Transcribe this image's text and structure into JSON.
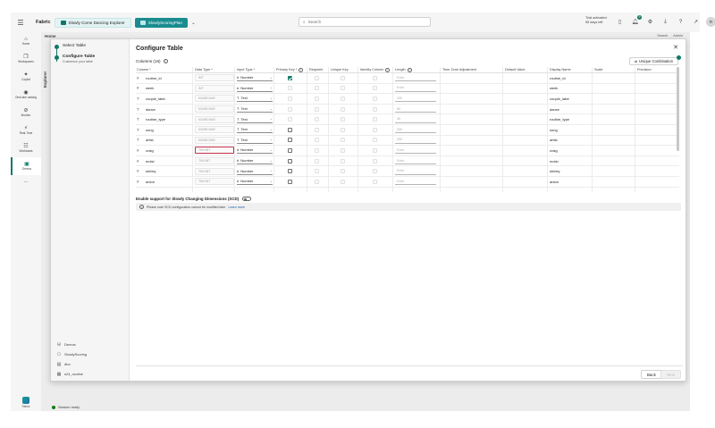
{
  "topbar": {
    "app_name": "Fabric",
    "tabs": [
      {
        "label": "Slowly Come Dancing Explorer",
        "active": false
      },
      {
        "label": "SlowlyScoringPlan",
        "active": true
      }
    ],
    "add_tab": "+",
    "search_placeholder": "Search",
    "trial_line1": "Trial activated:",
    "trial_line2": "55 days left",
    "notification_count": "9",
    "avatar_initials": "R"
  },
  "rail": {
    "items": [
      {
        "label": "Home",
        "icon": "home-icon"
      },
      {
        "label": "Workspaces",
        "icon": "workspaces-icon"
      },
      {
        "label": "Copilot",
        "icon": "copilot-icon"
      },
      {
        "label": "OneLake catalog",
        "icon": "onelake-icon"
      },
      {
        "label": "Monitor",
        "icon": "monitor-icon"
      },
      {
        "label": "Real-Time",
        "icon": "realtime-icon"
      },
      {
        "label": "Workloads",
        "icon": "workloads-icon"
      },
      {
        "label": "Demos",
        "icon": "demos-icon"
      }
    ],
    "more": "...",
    "bottom_label": "Fabric"
  },
  "background": {
    "home_tab": "Home",
    "explorer_label": "Explorer",
    "btn1": "Search",
    "btn2": "Admin"
  },
  "statusbar": {
    "text": "Session ready"
  },
  "wizard": {
    "steps": [
      {
        "title": "Select Table",
        "subtitle": ""
      },
      {
        "title": "Configure Table",
        "subtitle": "Customize your table"
      }
    ],
    "footer_items": [
      {
        "label": "Demos",
        "icon": "database-icon"
      },
      {
        "label": "SlowlyScoring",
        "icon": "schema-icon"
      },
      {
        "label": "dbo",
        "icon": "folder-icon"
      },
      {
        "label": "s24_routine",
        "icon": "table-icon"
      }
    ]
  },
  "dialog": {
    "title": "Configure Table",
    "close": "✕",
    "columns_count": "Columns (16)",
    "unique_combination": "Unique Combination",
    "headers": {
      "columns": "Column *",
      "data_type": "Data Type *",
      "input_type": "Input Type *",
      "primary_key": "Primary Key *",
      "required": "Required",
      "unique_key": "Unique Key",
      "identity": "Identity Column",
      "length": "Length",
      "tz": "Time Zone Adjustment",
      "default": "Default Value",
      "display": "Display Name",
      "scale": "Scale",
      "precision": "Precision"
    },
    "rows": [
      {
        "type_icon": "#",
        "name": "routine_id",
        "data_type": "INT",
        "input": "Number",
        "input_icon": "#",
        "pk": "on",
        "pk_enabled": true,
        "req": "dis",
        "uniq": "dis",
        "ident": "dis",
        "length": "Enter",
        "len_val": false,
        "display": "routine_id",
        "err": false
      },
      {
        "type_icon": "#",
        "name": "week",
        "data_type": "INT",
        "input": "Number",
        "input_icon": "#",
        "pk": "dis",
        "pk_enabled": false,
        "req": "dis",
        "uniq": "dis",
        "ident": "dis",
        "length": "Enter",
        "len_val": false,
        "display": "week",
        "err": false
      },
      {
        "type_icon": "T",
        "name": "couple_label",
        "data_type": "NVARCHAR",
        "input": "Text",
        "input_icon": "T",
        "pk": "dis",
        "pk_enabled": false,
        "req": "dis",
        "uniq": "dis",
        "ident": "dis",
        "length": "100",
        "len_val": true,
        "display": "couple_label",
        "err": false
      },
      {
        "type_icon": "T",
        "name": "dance",
        "data_type": "NVARCHAR",
        "input": "Text",
        "input_icon": "T",
        "pk": "dis",
        "pk_enabled": false,
        "req": "dis",
        "uniq": "dis",
        "ident": "dis",
        "length": "60",
        "len_val": true,
        "display": "dance",
        "err": false
      },
      {
        "type_icon": "T",
        "name": "routine_type",
        "data_type": "NVARCHAR",
        "input": "Text",
        "input_icon": "T",
        "pk": "dis",
        "pk_enabled": false,
        "req": "dis",
        "uniq": "dis",
        "ident": "dis",
        "length": "30",
        "len_val": true,
        "display": "routine_type",
        "err": false
      },
      {
        "type_icon": "T",
        "name": "song",
        "data_type": "NVARCHAR",
        "input": "Text",
        "input_icon": "T",
        "pk": "off",
        "pk_enabled": true,
        "req": "dis",
        "uniq": "dis",
        "ident": "dis",
        "length": "200",
        "len_val": true,
        "display": "song",
        "err": false
      },
      {
        "type_icon": "T",
        "name": "artist",
        "data_type": "NVARCHAR",
        "input": "Text",
        "input_icon": "T",
        "pk": "off",
        "pk_enabled": true,
        "req": "dis",
        "uniq": "dis",
        "ident": "dis",
        "length": "200",
        "len_val": true,
        "display": "artist",
        "err": false
      },
      {
        "type_icon": "#",
        "name": "craig",
        "data_type": "TINYINT",
        "input": "Number",
        "input_icon": "#",
        "pk": "off",
        "pk_enabled": true,
        "req": "dis",
        "uniq": "dis",
        "ident": "dis",
        "length": "Enter",
        "len_val": false,
        "display": "craig",
        "err": true
      },
      {
        "type_icon": "#",
        "name": "motsi",
        "data_type": "TINYINT",
        "input": "Number",
        "input_icon": "#",
        "pk": "off",
        "pk_enabled": true,
        "req": "dis",
        "uniq": "dis",
        "ident": "dis",
        "length": "Enter",
        "len_val": false,
        "display": "motsi",
        "err": false
      },
      {
        "type_icon": "#",
        "name": "shirley",
        "data_type": "TINYINT",
        "input": "Number",
        "input_icon": "#",
        "pk": "off",
        "pk_enabled": true,
        "req": "dis",
        "uniq": "dis",
        "ident": "dis",
        "length": "Enter",
        "len_val": false,
        "display": "shirley",
        "err": false
      },
      {
        "type_icon": "#",
        "name": "anton",
        "data_type": "TINYINT",
        "input": "Number",
        "input_icon": "#",
        "pk": "off",
        "pk_enabled": true,
        "req": "dis",
        "uniq": "dis",
        "ident": "dis",
        "length": "Enter",
        "len_val": false,
        "display": "anton",
        "err": false
      }
    ],
    "scd_label": "Enable support for Slowly Changing Dimensions (SCD)",
    "notice_text": "Please note SCD configuration cannot be modified later",
    "notice_link": "Learn more",
    "back": "Back",
    "next": "Next"
  },
  "colors": {
    "accent": "#117865",
    "error": "#c4314b"
  }
}
